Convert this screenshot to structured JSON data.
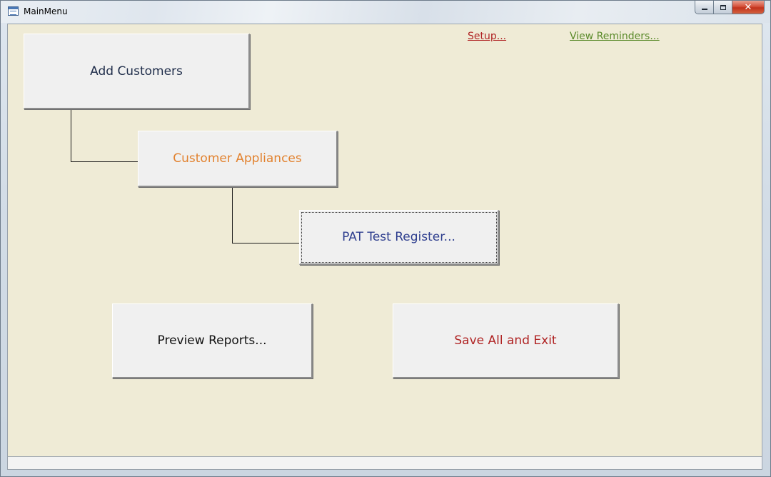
{
  "window": {
    "title": "MainMenu",
    "icon": "form-icon",
    "controls": {
      "minimize": "minimize",
      "maximize": "restore",
      "close": "close"
    }
  },
  "links": {
    "setup": {
      "label": "Setup...",
      "color": "#b02424"
    },
    "reminders": {
      "label": "View Reminders...",
      "color": "#5a8a2a"
    }
  },
  "buttons": {
    "add_customers": {
      "label": "Add Customers",
      "color": "#1f2d4a"
    },
    "customer_appliances": {
      "label": "Customer Appliances",
      "color": "#e2822f"
    },
    "pat_register": {
      "label": "PAT Test Register...",
      "color": "#2f3f8f"
    },
    "preview_reports": {
      "label": "Preview Reports...",
      "color": "#111111"
    },
    "save_exit": {
      "label": "Save All and Exit",
      "color": "#b02424"
    }
  },
  "colors": {
    "form_background": "#efebd6",
    "button_face": "#f0f0f0"
  }
}
